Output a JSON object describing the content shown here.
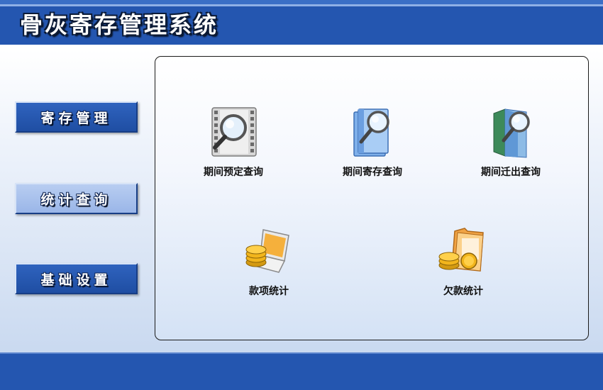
{
  "app": {
    "title": "骨灰寄存管理系统"
  },
  "nav": [
    {
      "label": "寄存管理",
      "state": "normal"
    },
    {
      "label": "统计查询",
      "state": "active"
    },
    {
      "label": "基础设置",
      "state": "normal"
    }
  ],
  "items": [
    {
      "label": "期间预定查询",
      "icon": "film-magnifier-icon"
    },
    {
      "label": "期间寄存查询",
      "icon": "book-magnifier-icon"
    },
    {
      "label": "期间迁出查询",
      "icon": "folder-magnifier-icon"
    },
    {
      "label": "款项统计",
      "icon": "laptop-coins-icon"
    },
    {
      "label": "欠款统计",
      "icon": "folder-coins-icon"
    }
  ],
  "colors": {
    "header_blue": "#2456b0",
    "nav_active": "#a9c2ee",
    "coin_gold": "#f2b51c"
  }
}
